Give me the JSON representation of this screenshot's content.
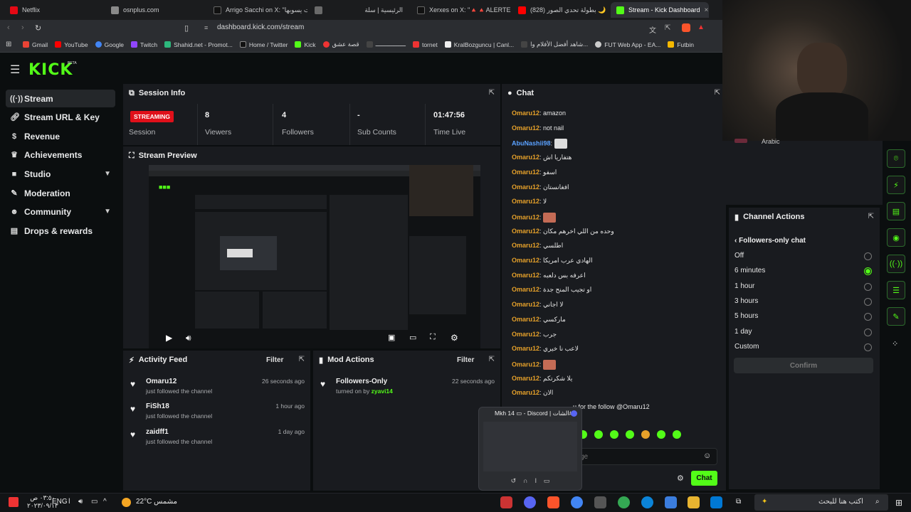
{
  "browser": {
    "tabs": [
      {
        "title": "Netflix",
        "color": "#e50914"
      },
      {
        "title": "osnplus.com",
        "color": "#8a8a8a"
      },
      {
        "title": "Arrigo Sacchi on X: \"بولات يسوبها ...\"",
        "color": "#111111"
      },
      {
        "title": "الرئيسية | سلة",
        "color": "#6a6a6a"
      },
      {
        "title": "Xerxes on X: \"🔺🔺ALERTE DU",
        "color": "#111111"
      },
      {
        "title": "(828) بطولة تحدي الصور 🌙",
        "color": "#ff0000"
      },
      {
        "title": "Stream - Kick Dashboard",
        "color": "#53fc18"
      }
    ],
    "url": "dashboard.kick.com/stream",
    "bookmarks": [
      {
        "label": "Gmail",
        "color": "#ea4335"
      },
      {
        "label": "YouTube",
        "color": "#ff0000"
      },
      {
        "label": "Google",
        "color": "#4285f4"
      },
      {
        "label": "Twitch",
        "color": "#9146ff"
      },
      {
        "label": "Shahid.net - Promot...",
        "color": "#2db87d"
      },
      {
        "label": "Home / Twitter",
        "color": "#111111"
      },
      {
        "label": "Kick",
        "color": "#53fc18"
      },
      {
        "label": "قصة عشق",
        "color": "#e33"
      },
      {
        "label": "ـــــــــــــــــ",
        "color": "#444"
      },
      {
        "label": "tornet",
        "color": "#e33"
      },
      {
        "label": "KralBozguncu | Canl...",
        "color": "#eee"
      },
      {
        "label": "شاهد أفضل الأفلام وا...",
        "color": "#444"
      },
      {
        "label": "FUT Web App - EA...",
        "color": "#ccc"
      },
      {
        "label": "Futbin",
        "color": "#f5b800"
      }
    ]
  },
  "brand": {
    "logo": "KICK",
    "beta": "BETA",
    "accent": "#53fc18"
  },
  "sidebar": {
    "items": [
      {
        "label": "Stream",
        "icon": "broadcast-icon"
      },
      {
        "label": "Stream URL & Key",
        "icon": "link-icon"
      },
      {
        "label": "Revenue",
        "icon": "dollar-icon"
      },
      {
        "label": "Achievements",
        "icon": "trophy-icon"
      },
      {
        "label": "Studio",
        "icon": "camera-icon"
      },
      {
        "label": "Moderation",
        "icon": "wrench-icon"
      },
      {
        "label": "Community",
        "icon": "people-icon"
      },
      {
        "label": "Drops & rewards",
        "icon": "gift-icon"
      }
    ]
  },
  "session": {
    "title": "Session Info",
    "status": "STREAMING",
    "session_label": "Session",
    "viewers": "8",
    "viewers_label": "Viewers",
    "followers": "4",
    "followers_label": "Followers",
    "subs": "-",
    "subs_label": "Sub Counts",
    "time": "01:47:56",
    "time_label": "Time Live"
  },
  "preview": {
    "title": "Stream Preview"
  },
  "activity": {
    "title": "Activity Feed",
    "filter": "Filter",
    "items": [
      {
        "name": "Omaru12",
        "sub": "just followed the channel",
        "time": "26 seconds ago"
      },
      {
        "name": "FiSh18",
        "sub": "just followed the channel",
        "time": "1 hour ago"
      },
      {
        "name": "zaidff1",
        "sub": "just followed the channel",
        "time": "1 day ago"
      }
    ]
  },
  "mod": {
    "title": "Mod Actions",
    "filter": "Filter",
    "item": {
      "name": "Followers-Only",
      "sub": "turned on by",
      "by": "zyavi14",
      "time": "22 seconds ago"
    }
  },
  "chat": {
    "title": "Chat",
    "messages": [
      {
        "user": "Omaru12",
        "text": "amazon"
      },
      {
        "user": "Omaru12",
        "text": "not nail"
      },
      {
        "user": "AbuNashii98",
        "text": ""
      },
      {
        "user": "Omaru12",
        "text": "هتفاريا اش"
      },
      {
        "user": "Omaru12",
        "text": "اسفو"
      },
      {
        "user": "Omaru12",
        "text": "افغانستان"
      },
      {
        "user": "Omaru12",
        "text": "لا"
      },
      {
        "user": "Omaru12",
        "text": ""
      },
      {
        "user": "Omaru12",
        "text": "وحده من اللي اخرهم مكان"
      },
      {
        "user": "Omaru12",
        "text": "اطلسي"
      },
      {
        "user": "Omaru12",
        "text": "الهادي عرب امريكا"
      },
      {
        "user": "Omaru12",
        "text": "اعرفه بس دلعبه"
      },
      {
        "user": "Omaru12",
        "text": "او تجيب المنح جدة"
      },
      {
        "user": "Omaru12",
        "text": "لا اجاني"
      },
      {
        "user": "Omaru12",
        "text": "ماركسي"
      },
      {
        "user": "Omaru12",
        "text": "جرب"
      },
      {
        "user": "Omaru12",
        "text": "لاعب نا خيري"
      },
      {
        "user": "Omaru12",
        "text": ""
      },
      {
        "user": "Omaru12",
        "text": "يلا شكرتكم"
      },
      {
        "user": "Omaru12",
        "text": "الان"
      }
    ],
    "last_line": "u for the follow @Omaru12",
    "placeholder": "ge",
    "send": "Chat"
  },
  "channel_actions": {
    "title": "Channel Actions",
    "subtitle": "Followers-only chat",
    "options": [
      "Off",
      "6 minutes",
      "1 hour",
      "3 hours",
      "5 hours",
      "1 day",
      "Custom"
    ],
    "selected": 1,
    "confirm": "Confirm",
    "arabic_tag": "Arabic"
  },
  "discord": {
    "title": "Mkh 14 ▭ - Discord | الشات#"
  },
  "taskbar": {
    "search": "اكتب هنا للبحث",
    "weather": "22°C  مشمس",
    "lang": "ENG",
    "time": "٠٣:٥٠ ص",
    "date": "٢٠٢٣/٠٩/١٣"
  }
}
